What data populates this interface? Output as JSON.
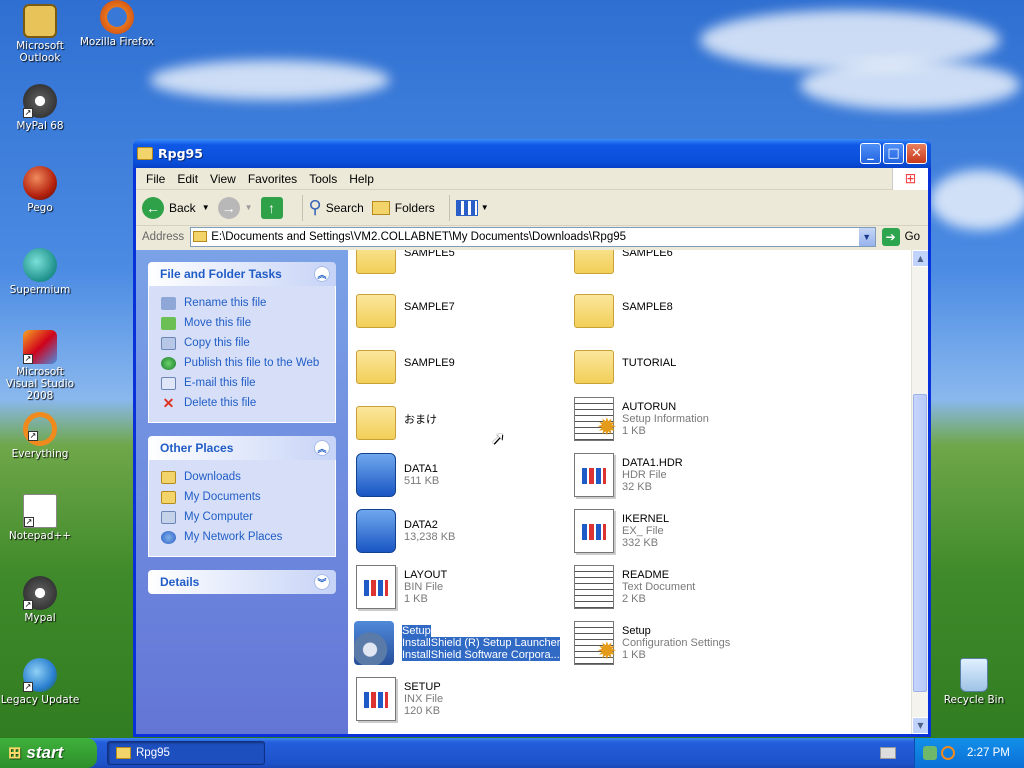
{
  "desktop": {
    "icons": [
      {
        "label": "Microsoft Outlook"
      },
      {
        "label": "Mozilla Firefox"
      },
      {
        "label": "MyPal 68"
      },
      {
        "label": "Pego"
      },
      {
        "label": "Supermium"
      },
      {
        "label": "Microsoft Visual Studio 2008"
      },
      {
        "label": "Everything"
      },
      {
        "label": "Notepad++"
      },
      {
        "label": "Mypal"
      },
      {
        "label": "Legacy Update"
      },
      {
        "label": "Recycle Bin"
      }
    ]
  },
  "window": {
    "title": "Rpg95",
    "menu": [
      "File",
      "Edit",
      "View",
      "Favorites",
      "Tools",
      "Help"
    ],
    "toolbar": {
      "back": "Back",
      "search": "Search",
      "folders": "Folders"
    },
    "address": {
      "label": "Address",
      "path": "E:\\Documents and Settings\\VM2.COLLABNET\\My Documents\\Downloads\\Rpg95",
      "go": "Go"
    }
  },
  "taskpane": {
    "file_tasks": {
      "title": "File and Folder Tasks",
      "items": [
        "Rename this file",
        "Move this file",
        "Copy this file",
        "Publish this file to the Web",
        "E-mail this file",
        "Delete this file"
      ]
    },
    "other_places": {
      "title": "Other Places",
      "items": [
        "Downloads",
        "My Documents",
        "My Computer",
        "My Network Places"
      ]
    },
    "details": {
      "title": "Details"
    }
  },
  "files": [
    {
      "name": "SAMPLE5",
      "line2": "",
      "line3": "",
      "icon": "folder"
    },
    {
      "name": "SAMPLE6",
      "line2": "",
      "line3": "",
      "icon": "folder"
    },
    {
      "name": "SAMPLE7",
      "line2": "",
      "line3": "",
      "icon": "folder"
    },
    {
      "name": "SAMPLE8",
      "line2": "",
      "line3": "",
      "icon": "folder"
    },
    {
      "name": "SAMPLE9",
      "line2": "",
      "line3": "",
      "icon": "folder"
    },
    {
      "name": "TUTORIAL",
      "line2": "",
      "line3": "",
      "icon": "folder"
    },
    {
      "name": "おまけ",
      "line2": "",
      "line3": "",
      "icon": "folder"
    },
    {
      "name": "AUTORUN",
      "line2": "Setup Information",
      "line3": "1 KB",
      "icon": "setup-info"
    },
    {
      "name": "DATA1",
      "line2": "511 KB",
      "line3": "",
      "icon": "installshield-data"
    },
    {
      "name": "DATA1.HDR",
      "line2": "HDR File",
      "line3": "32 KB",
      "icon": "generic-file"
    },
    {
      "name": "DATA2",
      "line2": "13,238 KB",
      "line3": "",
      "icon": "installshield-data"
    },
    {
      "name": "IKERNEL",
      "line2": "EX_ File",
      "line3": "332 KB",
      "icon": "generic-file"
    },
    {
      "name": "LAYOUT",
      "line2": "BIN File",
      "line3": "1 KB",
      "icon": "generic-file"
    },
    {
      "name": "README",
      "line2": "Text Document",
      "line3": "2 KB",
      "icon": "text-document"
    },
    {
      "name": "Setup",
      "line2": "InstallShield (R) Setup Launcher",
      "line3": "InstallShield Software Corpora...",
      "icon": "installer"
    },
    {
      "name": "Setup",
      "line2": "Configuration Settings",
      "line3": "1 KB",
      "icon": "config"
    },
    {
      "name": "SETUP",
      "line2": "INX File",
      "line3": "120 KB",
      "icon": "generic-file"
    }
  ],
  "taskbar": {
    "start": "start",
    "task": "Rpg95",
    "clock": "2:27 PM"
  }
}
